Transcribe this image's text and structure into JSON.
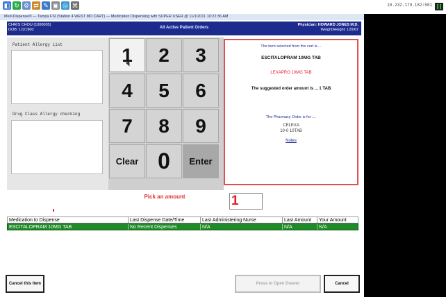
{
  "remote": {
    "address": "10.232.179.182:581"
  },
  "window": {
    "title": "Med-Dispense® — Tampa FSI (Station 4 WEST MD CART) — Medication Dispensing with SUPER USER @ 11/1/2011 10:22:36 AM"
  },
  "header": {
    "patient_name": "CHRIS CHOU (1000005)",
    "patient_dob": "DOB: 1/1/1960",
    "title": "All Active Patient Orders",
    "physician": "Physician: HOWARD JONES M.D.",
    "weight_height": "Weight/Height: 120/67"
  },
  "left_panel": {
    "allergy_label": "Patient Allergy List",
    "class_label": "Drug Class Allergy checking"
  },
  "keypad": {
    "keys": [
      "1",
      "2",
      "3",
      "4",
      "5",
      "6",
      "7",
      "8",
      "9",
      "Clear",
      "0",
      "Enter"
    ]
  },
  "info": {
    "selected_text": "The item selected from the cart is ...",
    "drug_name": "ESCITALOPRAM 10MG TAB",
    "brand_name": "LEXAPRO 10MG TAB",
    "suggested": "The suggested order amount is ... 1 TAB",
    "pharmacy_text": "The Pharmacy Order is for ....",
    "pharmacy_drug": "CELEXA",
    "pharmacy_qty": "10-0 10TAB",
    "notes_link": "Notes"
  },
  "prompt": "Pick an amount",
  "amount_value": "1",
  "table": {
    "headers": [
      "Medication to Dispense",
      "Last Dispense Date/Time",
      "Last Administering Nurse",
      "Last Amount",
      "Your Amount"
    ],
    "rows": [
      [
        "ESCITALOPRAM 10MG TAB",
        "No Recent Dispenses",
        "N/A",
        "N/A",
        "N/A"
      ]
    ]
  },
  "buttons": {
    "cancel_item": "Cancel this Item",
    "open_drawer": "Press to Open Drawer",
    "cancel": "Cancel"
  },
  "colors": {
    "header_bg": "#1e2b8e",
    "row_selected": "#1f8a28",
    "alert_red": "#e03030"
  }
}
